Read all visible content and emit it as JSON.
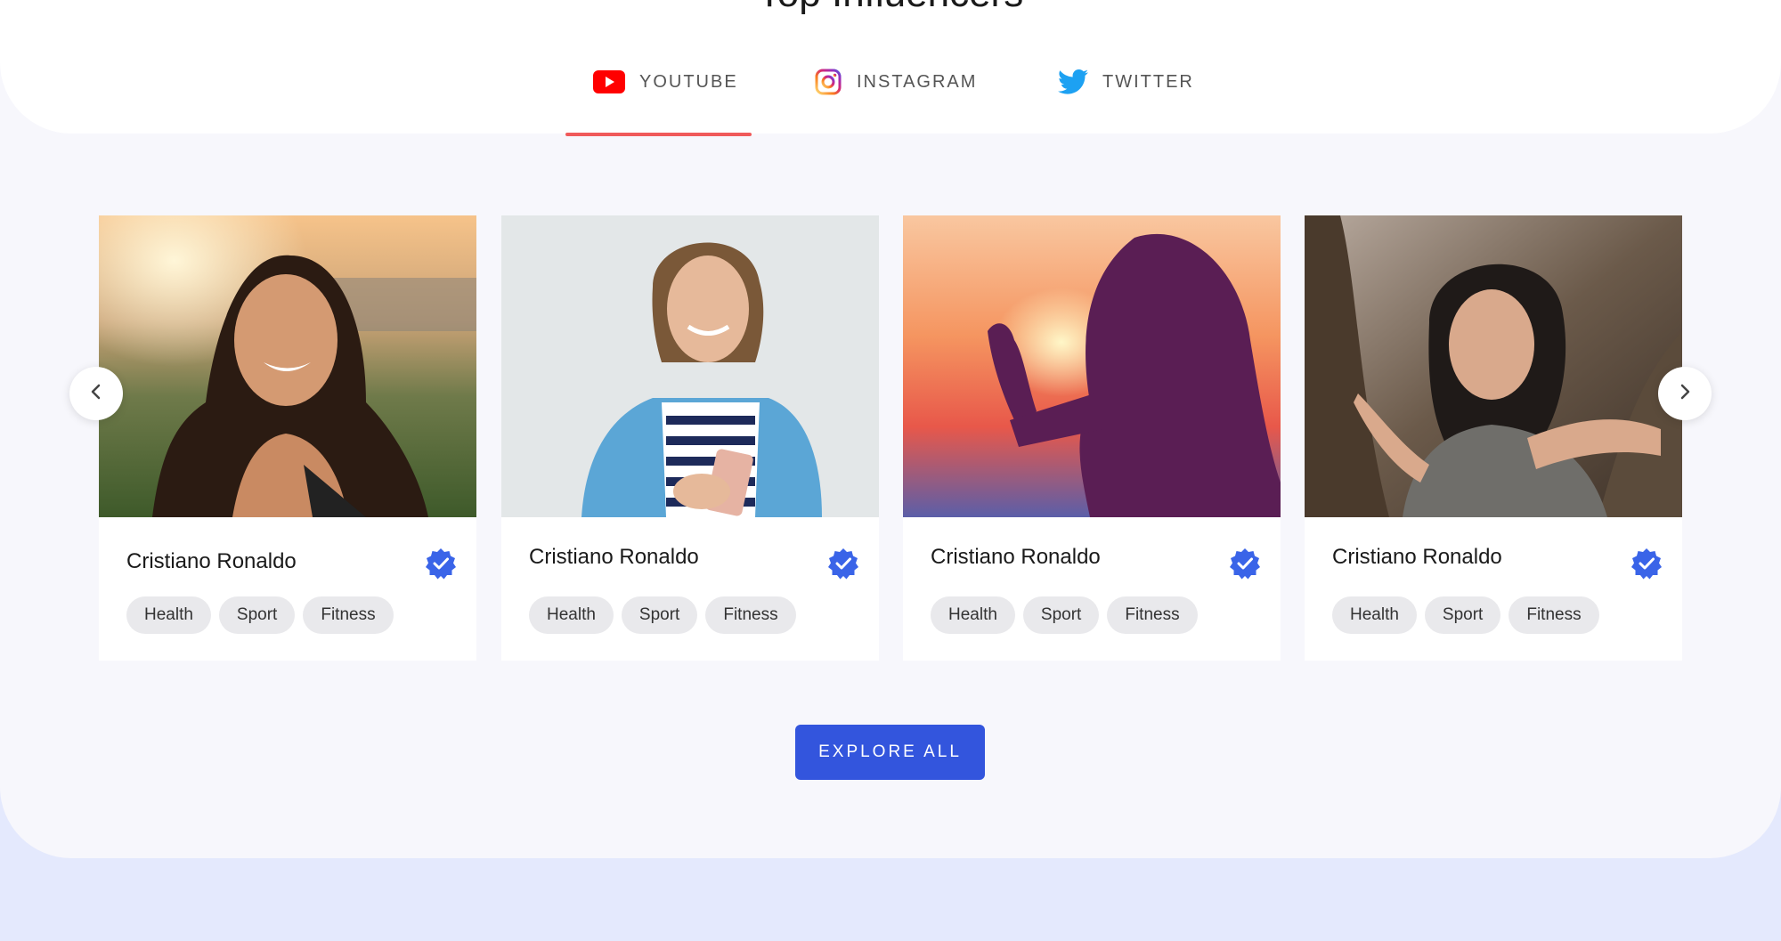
{
  "section": {
    "title": "Top Influencers"
  },
  "tabs": [
    {
      "label": "YOUTUBE",
      "icon": "youtube-icon",
      "active": true
    },
    {
      "label": "INSTAGRAM",
      "icon": "instagram-icon",
      "active": false
    },
    {
      "label": "TWITTER",
      "icon": "twitter-icon",
      "active": false
    }
  ],
  "cards": [
    {
      "name": "Cristiano Ronaldo",
      "verified": true,
      "tags": [
        "Health",
        "Sport",
        "Fitness"
      ]
    },
    {
      "name": "Cristiano Ronaldo",
      "verified": true,
      "tags": [
        "Health",
        "Sport",
        "Fitness"
      ]
    },
    {
      "name": "Cristiano Ronaldo",
      "verified": true,
      "tags": [
        "Health",
        "Sport",
        "Fitness"
      ]
    },
    {
      "name": "Cristiano Ronaldo",
      "verified": true,
      "tags": [
        "Health",
        "Sport",
        "Fitness"
      ]
    }
  ],
  "carousel": {
    "prev_icon": "chevron-left-icon",
    "next_icon": "chevron-right-icon"
  },
  "cta": {
    "label": "EXPLORE ALL"
  },
  "colors": {
    "accent": "#3355dd",
    "tab_underline": "#f05a5a",
    "verified": "#3a64e8",
    "youtube": "#ff0000",
    "twitter": "#1da1f2"
  }
}
